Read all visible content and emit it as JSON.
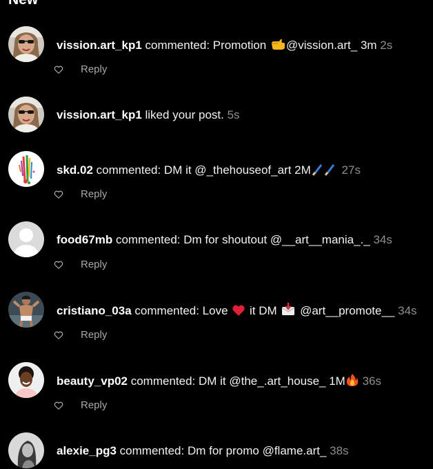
{
  "section": {
    "title": "New"
  },
  "items": [
    {
      "user": "vission.art_kp1",
      "text": " commented: Promotion ",
      "text2": "@vission.art_ 3m",
      "time": "2s",
      "reply": "Reply",
      "avatar_icon": "woman-sunglasses-avatar",
      "emoji": "pointing-hand"
    },
    {
      "user": "vission.art_kp1",
      "text": " liked your post. ",
      "time": "5s",
      "avatar_icon": "woman-sunglasses-avatar"
    },
    {
      "user": "skd.02",
      "text": " commented: DM it @_thehouseof_art 2M",
      "time": "27s",
      "reply": "Reply",
      "avatar_icon": "paint-splash-avatar",
      "emoji": "paintbrushes"
    },
    {
      "user": "food67mb",
      "text": " commented: Dm for shoutout @__art__mania_._ ",
      "time": "34s",
      "reply": "Reply",
      "avatar_icon": "default-avatar"
    },
    {
      "user": "cristiano_03a",
      "text": " commented: Love ",
      "text2": " it DM ",
      "text3": " @art__promote__ ",
      "time": "34s",
      "reply": "Reply",
      "avatar_icon": "athlete-avatar",
      "emoji": "red-heart",
      "emoji2": "envelope-arrow"
    },
    {
      "user": "beauty_vp02",
      "text": " commented: DM it @the_.art_house_ 1M",
      "time": "36s",
      "reply": "Reply",
      "avatar_icon": "woman-smiling-avatar",
      "emoji": "fire"
    },
    {
      "user": "alexie_pg3",
      "text": " commented: Dm for promo @flame.art_ ",
      "time": "38s",
      "avatar_icon": "portrait-bw-avatar"
    }
  ],
  "colors": {
    "background": "#000000",
    "text": "#f2f2f2",
    "muted": "#8e8e8e",
    "reply": "#a8a8a8"
  }
}
